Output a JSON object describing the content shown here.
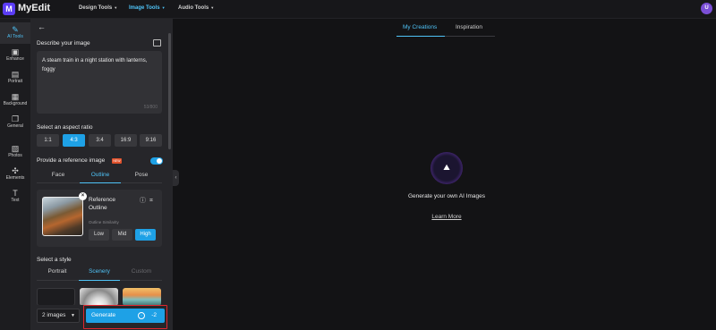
{
  "app": {
    "logo_letter": "M",
    "brand": "MyEdit"
  },
  "topnav": [
    {
      "label": "Design Tools",
      "active": false
    },
    {
      "label": "Image Tools",
      "active": true
    },
    {
      "label": "Audio Tools",
      "active": false
    }
  ],
  "user": {
    "avatar_letter": "U"
  },
  "rail": [
    {
      "label": "AI Tools",
      "icon": "magic-wand-icon",
      "active": true
    },
    {
      "label": "Enhance",
      "icon": "enhance-icon",
      "active": false
    },
    {
      "label": "Portrait",
      "icon": "portrait-icon",
      "active": false
    },
    {
      "label": "Background",
      "icon": "background-icon",
      "active": false
    },
    {
      "label": "General",
      "icon": "general-icon",
      "active": false
    },
    {
      "label": "Photos",
      "icon": "photos-icon",
      "active": false
    },
    {
      "label": "Elements",
      "icon": "elements-icon",
      "active": false
    },
    {
      "label": "Text",
      "icon": "text-icon",
      "active": false
    }
  ],
  "describe": {
    "label": "Describe your image",
    "value": "A steam train in a night station with lanterns, foggy",
    "counter": "53/800"
  },
  "aspect": {
    "label": "Select an aspect ratio",
    "options": [
      "1:1",
      "4:3",
      "3:4",
      "16:9",
      "9:16"
    ],
    "selected": "4:3"
  },
  "reference": {
    "label": "Provide a reference image",
    "badge": "NEW",
    "enabled": true,
    "tabs": [
      "Face",
      "Outline",
      "Pose"
    ],
    "active_tab": "Outline",
    "card_title": "Reference Outline",
    "similarity_label": "Outline Similarity",
    "similarity_options": [
      "Low",
      "Mid",
      "High"
    ],
    "similarity_selected": "High"
  },
  "style": {
    "label": "Select a style",
    "tabs": [
      "Portrait",
      "Scenery",
      "Custom"
    ],
    "active_tab": "Scenery"
  },
  "bottom": {
    "count_select": "2 images",
    "generate_label": "Generate",
    "cost": "-2"
  },
  "main": {
    "tabs": [
      "My Creations",
      "Inspiration"
    ],
    "active_tab": "My Creations",
    "empty_title": "Generate your own AI Images",
    "learn_more": "Learn More"
  },
  "colors": {
    "accent": "#1ea1e6",
    "highlight": "#e0262e",
    "brand": "#5b3df5"
  }
}
